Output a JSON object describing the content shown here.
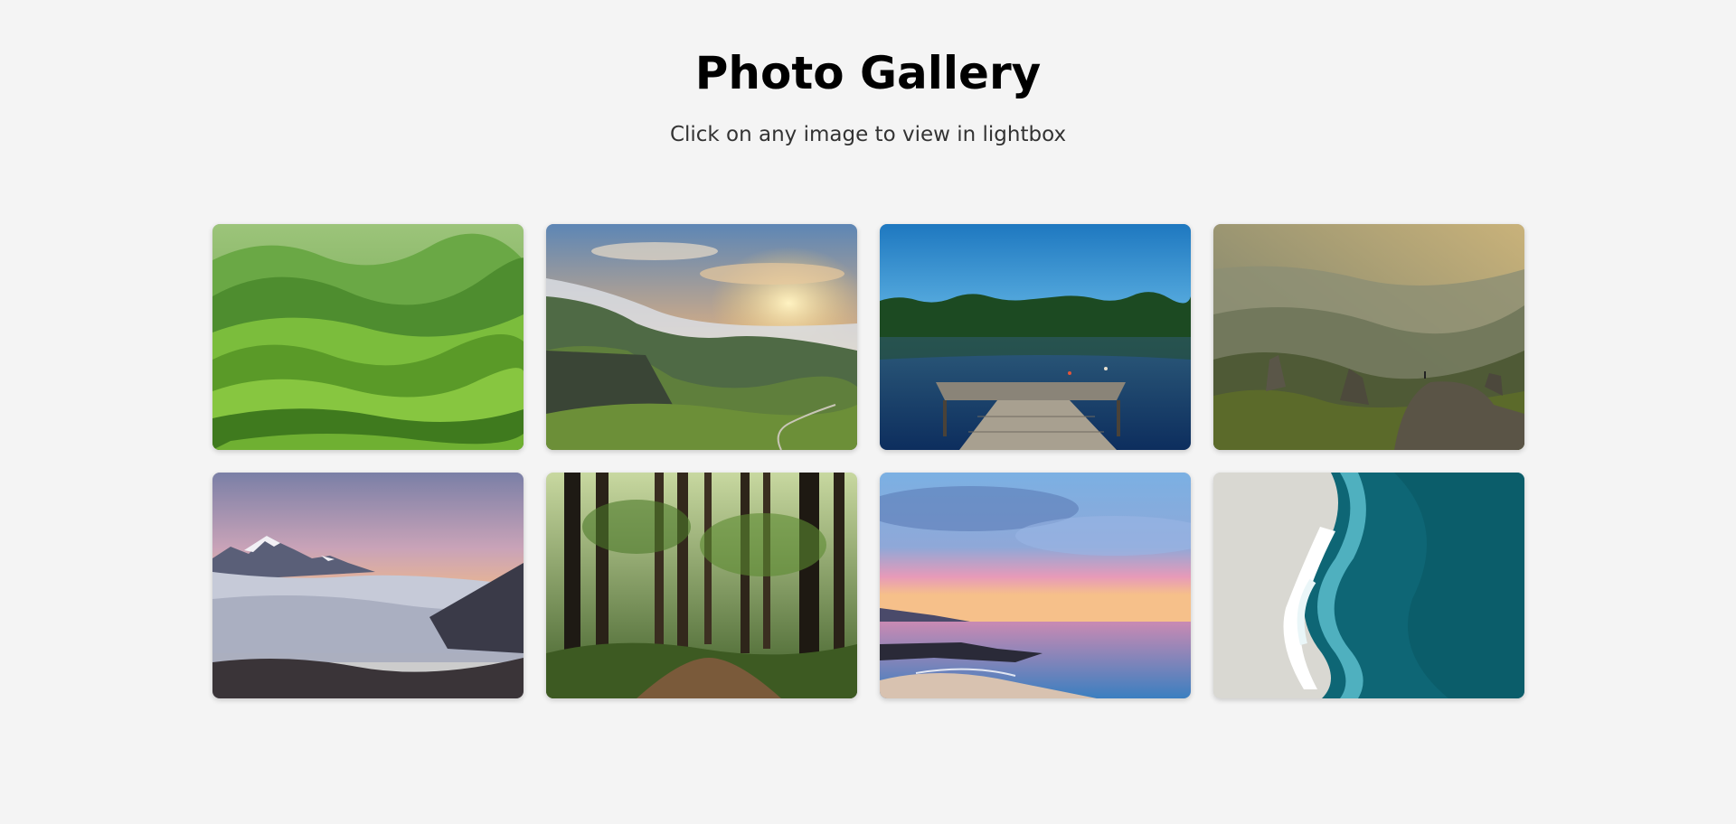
{
  "header": {
    "title": "Photo Gallery",
    "subtitle": "Click on any image to view in lightbox"
  },
  "gallery": {
    "images": [
      {
        "subject": "green rolling hills"
      },
      {
        "subject": "misty mountain valley at sunrise"
      },
      {
        "subject": "wooden dock on calm lake"
      },
      {
        "subject": "golden hazy mountains with hiker"
      },
      {
        "subject": "snowy peaks above sea of clouds"
      },
      {
        "subject": "forest path among tall trees"
      },
      {
        "subject": "pink sunset over rocky beach"
      },
      {
        "subject": "aerial view of wave on sandy shore"
      }
    ]
  },
  "colors": {
    "background": "#f4f4f4",
    "title": "#000000",
    "subtitle": "#333333"
  }
}
